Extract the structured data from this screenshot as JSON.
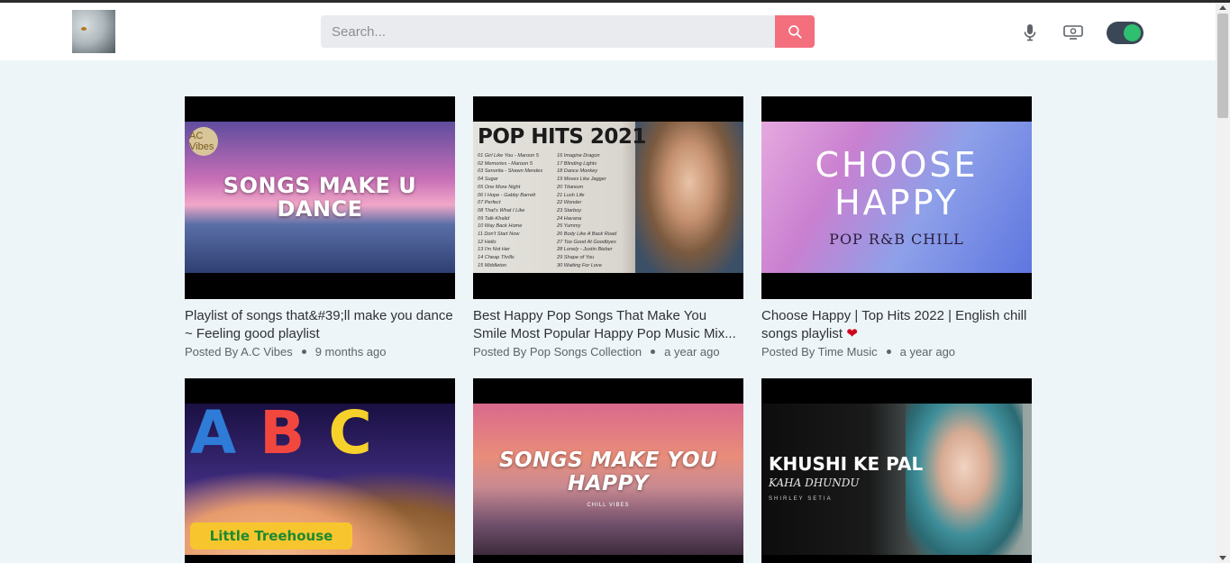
{
  "header": {
    "logo_alt": "",
    "search": {
      "placeholder": "Search...",
      "value": ""
    },
    "icons": {
      "search": "search-icon",
      "mic": "microphone-icon",
      "cast": "cast-icon",
      "theme": "theme-toggle"
    },
    "theme_toggle_on": true
  },
  "colors": {
    "search_button": "#f36f7e",
    "toggle_bg": "#3a4756",
    "toggle_knob": "#2fbf71",
    "page_bg": "#eef5f8"
  },
  "videos": [
    {
      "thumb_text": "SONGS MAKE U DANCE",
      "thumb_badge": "AC Vibes",
      "title": "Playlist of songs that&#39;ll make you dance ~ Feeling good playlist",
      "posted_by": "Posted By A.C Vibes",
      "ago": "9 months ago"
    },
    {
      "thumb_heading": "POP HITS 2021",
      "thumb_list": [
        "01 Girl Like You - Maroon 5",
        "02 Memories - Maroon 5",
        "03 Senorita - Shawn Mendes",
        "04 Sugar",
        "05 One More Night",
        "06 I Hope - Gabby Barrett",
        "07 Perfect",
        "08 That's What I Like",
        "09 Talk-Khalid",
        "10 Way Back Home",
        "11 Don't Start Now",
        "12 Hello",
        "13 I'm Not Her",
        "14 Cheap Thrills",
        "15 Middleton",
        "16 Imagine Dragon",
        "17 Blinding Lights",
        "18 Dance Monkey",
        "19 Moves Like Jagger",
        "20 Titanium",
        "21 Lush Life",
        "22 Wonder",
        "23 Starboy",
        "24 Havana",
        "25 Yummy",
        "26 Body Like A Back Road",
        "27 Too Good At Goodbyes",
        "28 Lonely - Justin Bieber",
        "29 Shape of You",
        "30 Waiting For Love"
      ],
      "title": "Best Happy Pop Songs That Make You Smile Most Popular Happy Pop Music Mix...",
      "posted_by": "Posted By Pop Songs Collection",
      "ago": "a year ago"
    },
    {
      "thumb_text": "CHOOSE HAPPY",
      "thumb_sub": "POP R&B CHILL",
      "title": "Choose Happy | Top Hits 2022 | English chill songs playlist",
      "title_emoji": "❤",
      "posted_by": "Posted By Time Music",
      "ago": "a year ago"
    },
    {
      "thumb_letters": [
        "A",
        "B",
        "C"
      ],
      "thumb_brand": "Little Treehouse"
    },
    {
      "thumb_text": "SONGS MAKE YOU HAPPY",
      "thumb_sub": "CHILL VIBES"
    },
    {
      "thumb_text": "KHUSHI KE PAL",
      "thumb_sub": "KAHA DHUNDU",
      "thumb_tiny": "SHIRLEY SETIA"
    }
  ]
}
